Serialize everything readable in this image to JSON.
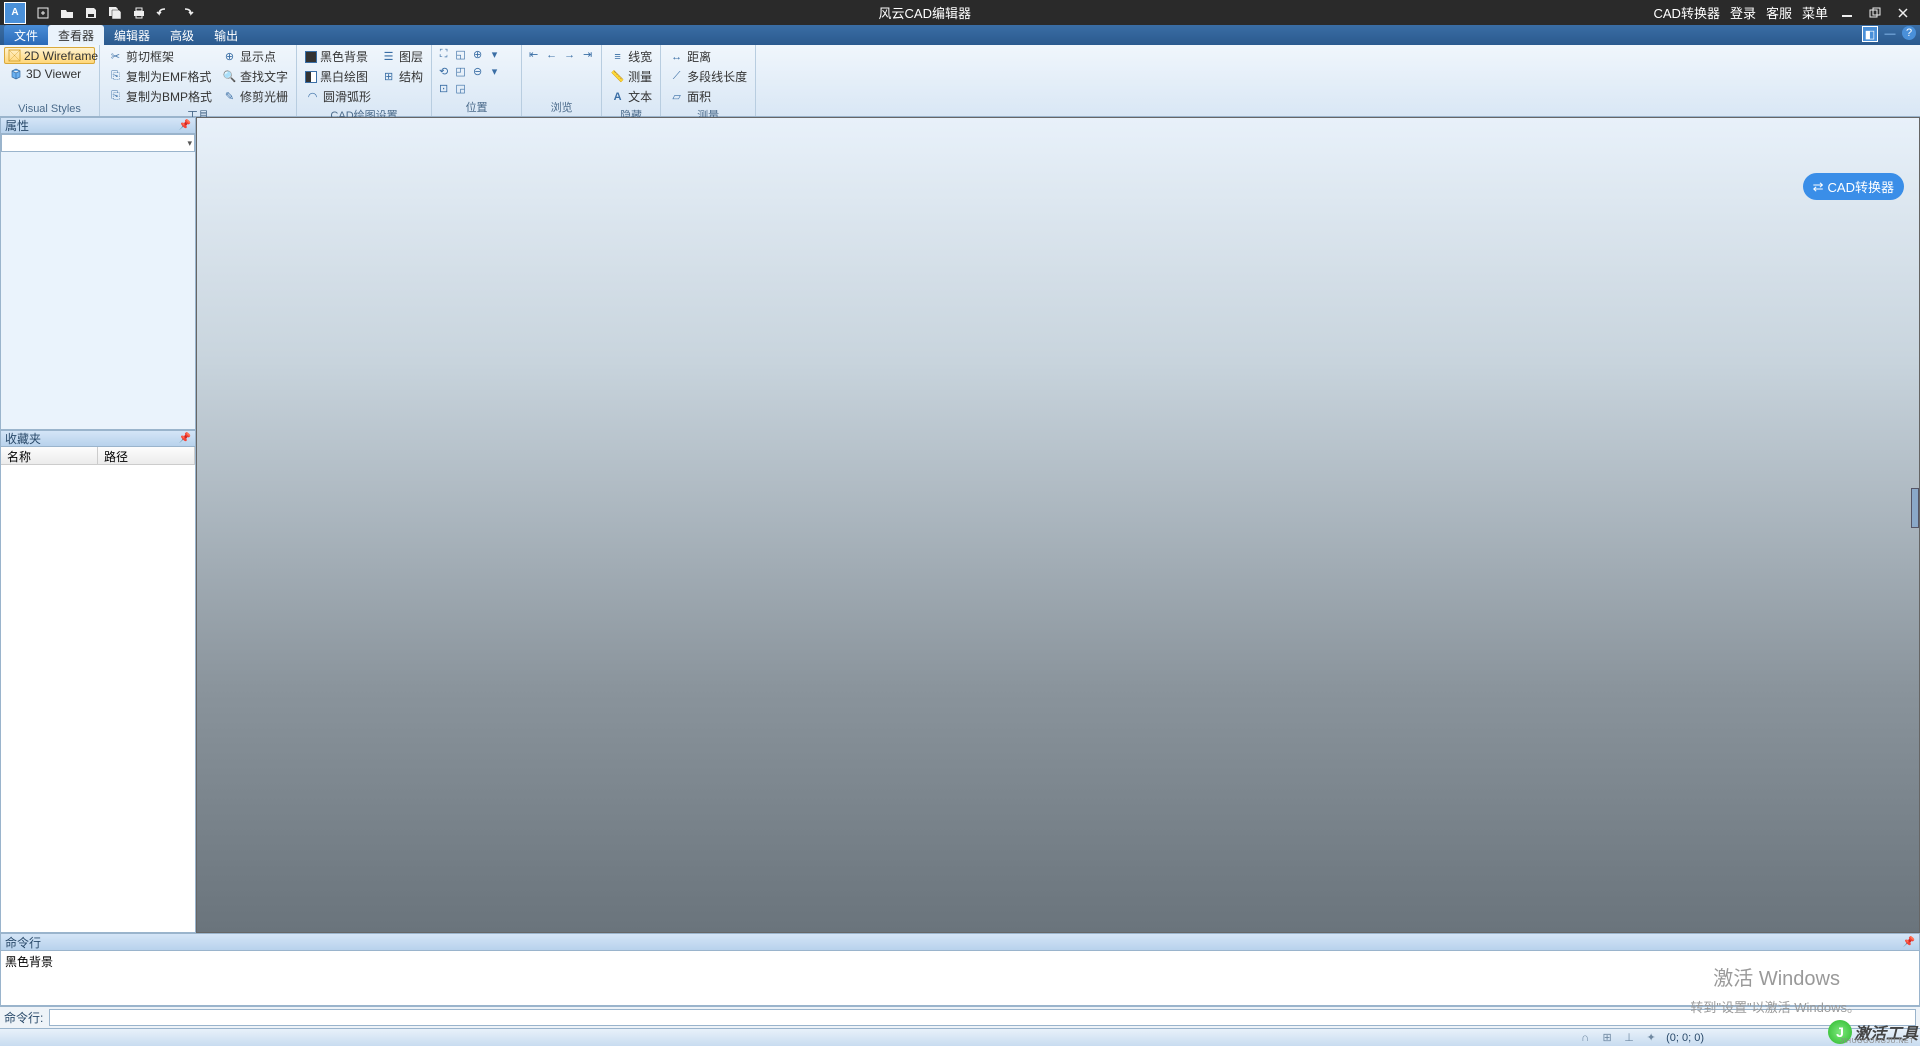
{
  "titlebar": {
    "title": "风云CAD编辑器",
    "right": {
      "converter": "CAD转换器",
      "login": "登录",
      "service": "客服",
      "menu": "菜单"
    }
  },
  "menutabs": {
    "file": "文件",
    "viewer": "查看器",
    "editor": "编辑器",
    "advanced": "高级",
    "output": "输出"
  },
  "ribbon": {
    "groups": {
      "visual_styles": {
        "title": "Visual Styles",
        "wireframe2d": "2D Wireframe",
        "viewer3d": "3D Viewer"
      },
      "tools": {
        "title": "工具",
        "clip_frame": "剪切框架",
        "copy_emf": "复制为EMF格式",
        "copy_bmp": "复制为BMP格式",
        "show_point": "显示点",
        "find_text": "查找文字",
        "trim_cursor": "修剪光栅"
      },
      "cad_draw": {
        "title": "CAD绘图设置",
        "black_bg": "黑色背景",
        "bw_draw": "黑白绘图",
        "arc_smooth": "圆滑弧形",
        "layer": "图层",
        "structure": "结构"
      },
      "position": {
        "title": "位置"
      },
      "browse": {
        "title": "浏览"
      },
      "hide": {
        "title": "隐藏",
        "line_width": "线宽",
        "measure": "测量",
        "text": "文本"
      },
      "measure": {
        "title": "测量",
        "distance": "距离",
        "polyline_len": "多段线长度",
        "area": "面积"
      }
    }
  },
  "panels": {
    "properties": {
      "title": "属性"
    },
    "favorites": {
      "title": "收藏夹",
      "col_name": "名称",
      "col_path": "路径"
    },
    "command": {
      "title": "命令行",
      "history_line": "黑色背景",
      "prompt": "命令行:"
    }
  },
  "canvas": {
    "badge": "CAD转换器"
  },
  "statusbar": {
    "coords": "(0; 0; 0)"
  },
  "watermark": {
    "line1": "激活 Windows",
    "line2": "转到\"设置\"以激活 Windows。",
    "tool": "激活工具",
    "tool_sub": "JIHUOGONGJU.NET"
  }
}
